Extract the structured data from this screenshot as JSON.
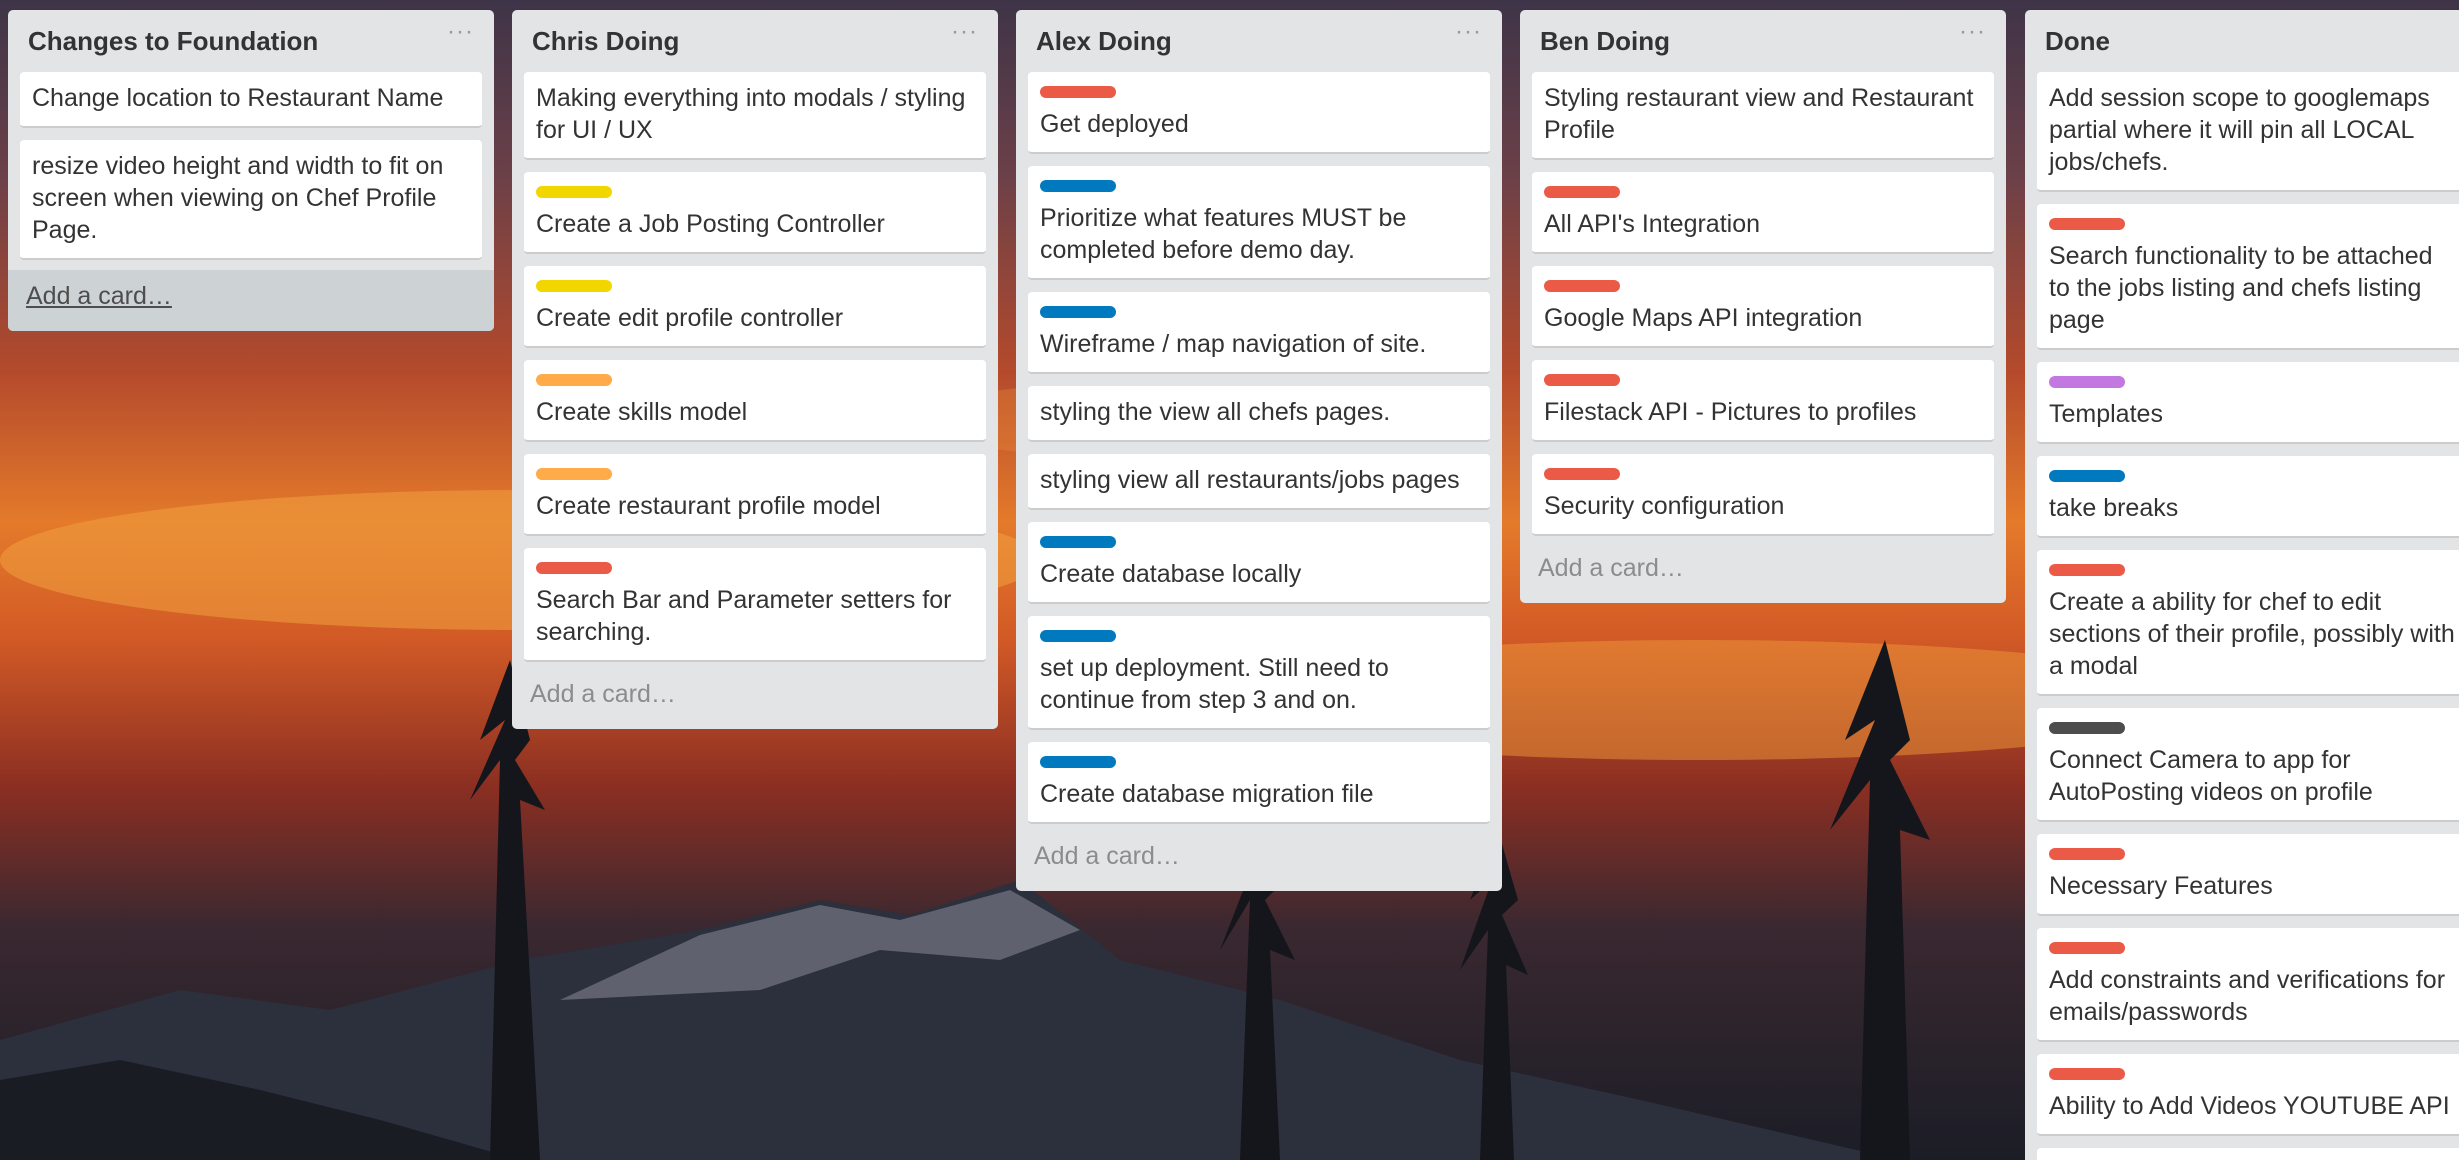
{
  "board": {
    "lists": [
      {
        "title": "Changes to Foundation",
        "cards": [
          {
            "text": "Change location to Restaurant Name"
          },
          {
            "text": "resize video height and width to fit on screen when viewing on Chef Profile Page."
          }
        ],
        "add_card": "Add a card…"
      },
      {
        "title": "Chris Doing",
        "cards": [
          {
            "text": "Making everything into modals / styling for UI / UX"
          },
          {
            "label": "#f2d600",
            "text": "Create a Job Posting Controller"
          },
          {
            "label": "#f2d600",
            "text": "Create edit profile controller"
          },
          {
            "label": "#ffab4a",
            "text": "Create skills model"
          },
          {
            "label": "#ffab4a",
            "text": "Create restaurant profile model"
          },
          {
            "label": "#eb5a46",
            "text": "Search Bar and Parameter setters for searching."
          }
        ],
        "add_card": "Add a card…"
      },
      {
        "title": "Alex Doing",
        "cards": [
          {
            "label": "#eb5a46",
            "text": "Get deployed"
          },
          {
            "label": "#0079bf",
            "text": "Prioritize what features MUST be completed before demo day."
          },
          {
            "label": "#0079bf",
            "text": "Wireframe / map navigation of site."
          },
          {
            "text": "styling the view all chefs pages."
          },
          {
            "text": "styling view all restaurants/jobs pages"
          },
          {
            "label": "#0079bf",
            "text": "Create database locally"
          },
          {
            "label": "#0079bf",
            "text": "set up deployment. Still need to continue from step 3 and on."
          },
          {
            "label": "#0079bf",
            "text": "Create database migration file"
          }
        ],
        "add_card": "Add a card…"
      },
      {
        "title": "Ben Doing",
        "cards": [
          {
            "text": "Styling restaurant view and Restaurant Profile"
          },
          {
            "label": "#eb5a46",
            "text": "All API's Integration"
          },
          {
            "label": "#eb5a46",
            "text": "Google Maps API integration"
          },
          {
            "label": "#eb5a46",
            "text": "Filestack API - Pictures to profiles"
          },
          {
            "label": "#eb5a46",
            "text": "Security configuration"
          }
        ],
        "add_card": "Add a card…"
      },
      {
        "title": "Done",
        "cards": [
          {
            "text": "Add session scope to googlemaps partial where it will pin all LOCAL jobs/chefs."
          },
          {
            "label": "#eb5a46",
            "text": "Search functionality to be attached to the jobs listing and chefs listing page"
          },
          {
            "label": "#c377e0",
            "text": "Templates"
          },
          {
            "label": "#0079bf",
            "text": "take breaks"
          },
          {
            "label": "#eb5a46",
            "text": "Create a ability for chef to edit sections of their profile, possibly with a modal"
          },
          {
            "label": "#4d4d4d",
            "text": "Connect Camera to app for AutoPosting videos on profile"
          },
          {
            "label": "#eb5a46",
            "text": "Necessary Features"
          },
          {
            "label": "#eb5a46",
            "text": "Add constraints and verifications for emails/passwords"
          },
          {
            "label": "#eb5a46",
            "text": "Ability to Add Videos YOUTUBE API"
          },
          {
            "label": "#c377e0",
            "text": ""
          }
        ]
      }
    ]
  }
}
